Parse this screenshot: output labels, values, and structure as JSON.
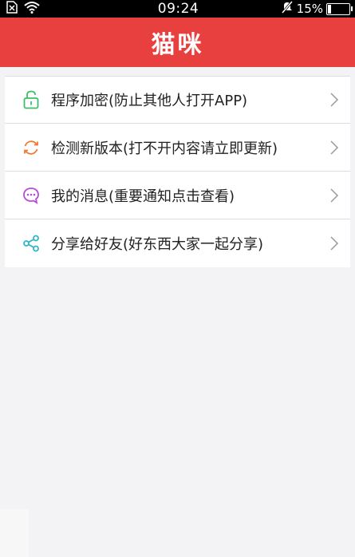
{
  "status_bar": {
    "time": "09:24",
    "battery_percent": "15%",
    "battery_level": 0.15,
    "icons": [
      "sim-missing-icon",
      "wifi-icon",
      "mute-icon",
      "battery-icon"
    ]
  },
  "header": {
    "title": "猫咪",
    "background": "#e8403f"
  },
  "menu": {
    "items": [
      {
        "label": "程序加密(防止其他人打开APP)",
        "icon": "lock-icon",
        "icon_color": "#3fbf6a"
      },
      {
        "label": "检测新版本(打不开内容请立即更新)",
        "icon": "refresh-icon",
        "icon_color": "#ef7a2f"
      },
      {
        "label": "我的消息(重要通知点击查看)",
        "icon": "message-icon",
        "icon_color": "#b64bd8"
      },
      {
        "label": "分享给好友(好东西大家一起分享)",
        "icon": "share-icon",
        "icon_color": "#2fb7c9"
      }
    ],
    "chevron_icon": "chevron-right-icon"
  }
}
